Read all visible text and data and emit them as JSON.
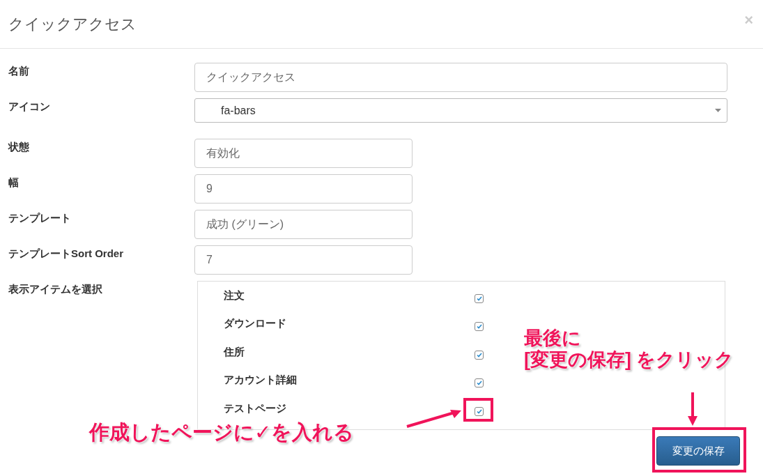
{
  "modal": {
    "title": "クイックアクセス",
    "close": "×"
  },
  "fields": [
    {
      "label": "名前",
      "kind": "text",
      "value": "クイックアクセス"
    },
    {
      "label": "アイコン",
      "kind": "select",
      "value": "fa-bars"
    },
    {
      "label": "状態",
      "kind": "text",
      "value": "有効化"
    },
    {
      "label": "幅",
      "kind": "text",
      "value": "9"
    },
    {
      "label": "テンプレート",
      "kind": "text",
      "value": "成功 (グリーン)"
    },
    {
      "label": "テンプレートSort Order",
      "kind": "text",
      "value": "7"
    }
  ],
  "items_select": {
    "label": "表示アイテムを選択",
    "items": [
      {
        "label": "注文",
        "checked": true
      },
      {
        "label": "ダウンロード",
        "checked": true
      },
      {
        "label": "住所",
        "checked": true
      },
      {
        "label": "アカウント詳細",
        "checked": true
      },
      {
        "label": "テストページ",
        "checked": true
      }
    ]
  },
  "save_button": "変更の保存",
  "annotations": {
    "check_note": "作成したページに✓を入れる",
    "save_note": "最後に\n[変更の保存] をクリック"
  }
}
